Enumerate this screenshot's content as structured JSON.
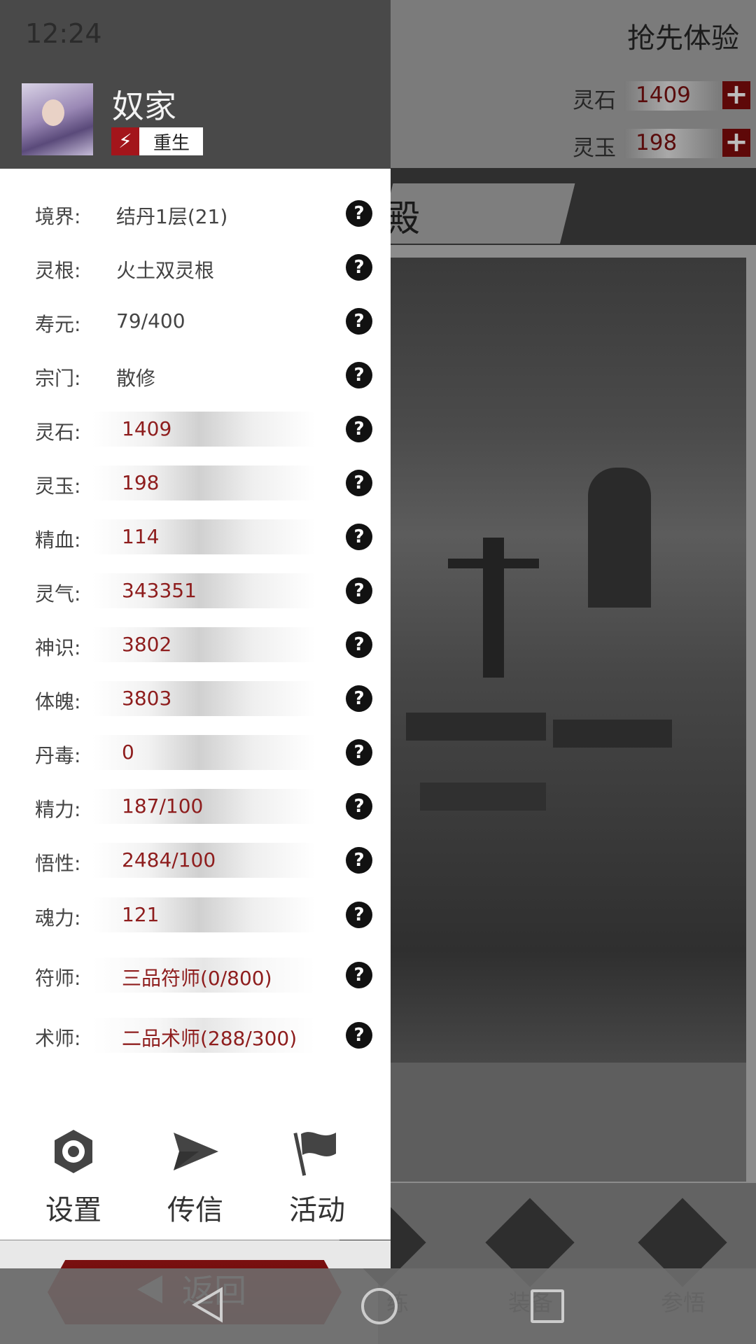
{
  "status_bar": {
    "time": "12:24"
  },
  "header": {
    "action_label": "抢先体验",
    "resources": [
      {
        "label": "灵石",
        "value": "1409",
        "plus": "+"
      },
      {
        "label": "灵玉",
        "value": "198",
        "plus": "+"
      }
    ],
    "tab_title": "殿"
  },
  "player": {
    "name": "奴家",
    "badge": "重生",
    "badge_icon": "⚡"
  },
  "stats": [
    {
      "label": "境界:",
      "value": "结丹1层(21)",
      "style": "plain"
    },
    {
      "label": "灵根:",
      "value": "火土双灵根",
      "style": "plain"
    },
    {
      "label": "寿元:",
      "value": "79/400",
      "style": "plain"
    },
    {
      "label": "宗门:",
      "value": "散修",
      "style": "plain"
    },
    {
      "label": "灵石:",
      "value": "1409",
      "style": "bar"
    },
    {
      "label": "灵玉:",
      "value": "198",
      "style": "bar"
    },
    {
      "label": "精血:",
      "value": "114",
      "style": "bar"
    },
    {
      "label": "灵气:",
      "value": "343351",
      "style": "bar"
    },
    {
      "label": "神识:",
      "value": "3802",
      "style": "bar"
    },
    {
      "label": "体魄:",
      "value": "3803",
      "style": "bar"
    },
    {
      "label": "丹毒:",
      "value": "0",
      "style": "bar"
    },
    {
      "label": "精力:",
      "value": "187/100",
      "style": "bar"
    },
    {
      "label": "悟性:",
      "value": "2484/100",
      "style": "bar"
    },
    {
      "label": "魂力:",
      "value": "121",
      "style": "bar"
    },
    {
      "label": "符师:",
      "value": "三品符师(0/800)",
      "style": "light"
    },
    {
      "label": "术师:",
      "value": "二品术师(288/300)",
      "style": "light"
    }
  ],
  "help_glyph": "?",
  "menu": [
    {
      "label": "设置",
      "icon": "gear-icon"
    },
    {
      "label": "传信",
      "icon": "send-icon"
    },
    {
      "label": "活动",
      "icon": "flag-icon"
    }
  ],
  "back_label": "返回",
  "bottom_nav": [
    {
      "label": "练",
      "icon": "train-icon"
    },
    {
      "label": "装备",
      "icon": "equipment-icon"
    },
    {
      "label": "参悟",
      "icon": "insight-icon"
    }
  ],
  "colors": {
    "accent_red": "#8e1d1d",
    "drawer_header": "#494949",
    "badge_red": "#a3151b"
  }
}
